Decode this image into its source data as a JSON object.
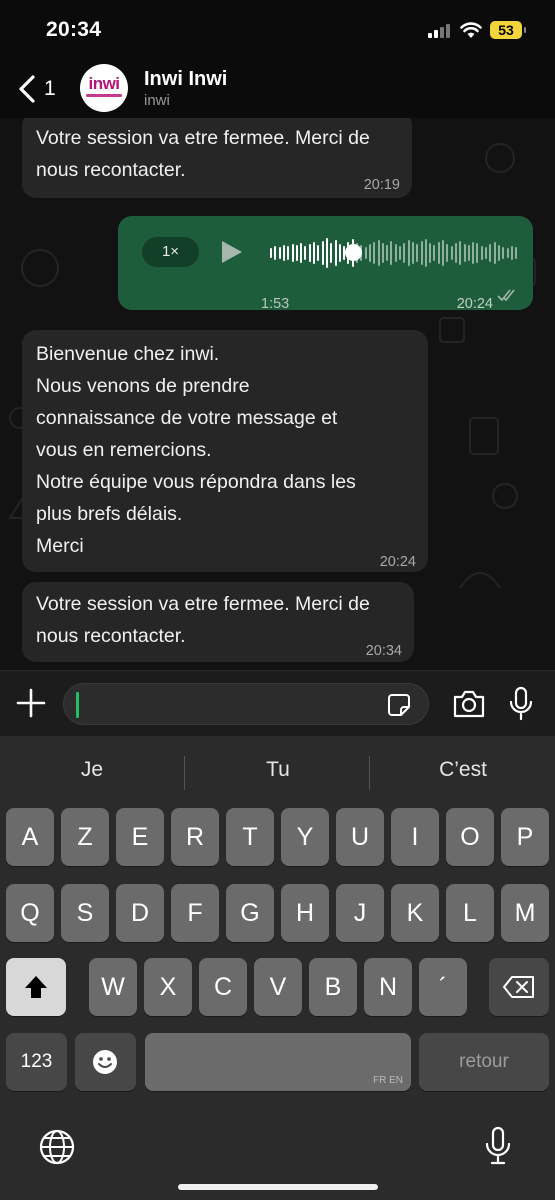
{
  "status_bar": {
    "time": "20:34",
    "battery": "53"
  },
  "header": {
    "back_count": "1",
    "contact_name": "Inwi Inwi",
    "contact_subtitle": "inwi",
    "avatar_logo": "inwi"
  },
  "messages": [
    {
      "direction": "in",
      "text": "Votre session va etre fermee. Merci de nous recontacter.",
      "time": "20:19"
    },
    {
      "direction": "out",
      "type": "voice",
      "speed": "1×",
      "duration": "1:53",
      "time": "20:24",
      "progress": 0.33,
      "status": "read"
    },
    {
      "direction": "in",
      "lines": [
        "Bienvenue chez inwi.",
        "Nous venons de prendre",
        "connaissance de votre message et",
        "vous en remercions.",
        "Notre équipe vous répondra dans les",
        "plus brefs délais.",
        "Merci"
      ],
      "time": "20:24"
    },
    {
      "direction": "in",
      "text": "Votre session va etre fermee. Merci de nous recontacter.",
      "time": "20:34"
    }
  ],
  "composer": {
    "value": ""
  },
  "keyboard": {
    "suggestions": [
      "Je",
      "Tu",
      "C’est"
    ],
    "row1": [
      "A",
      "Z",
      "E",
      "R",
      "T",
      "Y",
      "U",
      "I",
      "O",
      "P"
    ],
    "row2": [
      "Q",
      "S",
      "D",
      "F",
      "G",
      "H",
      "J",
      "K",
      "L",
      "M"
    ],
    "row3": [
      "W",
      "X",
      "C",
      "V",
      "B",
      "N",
      "´"
    ],
    "numbers_key": "123",
    "return_key": "retour",
    "space_languages": "FR EN"
  },
  "colors": {
    "incoming_bubble": "#262626",
    "outgoing_bubble": "#1e5d3b",
    "accent": "#21c063",
    "battery": "#f2d43d"
  }
}
